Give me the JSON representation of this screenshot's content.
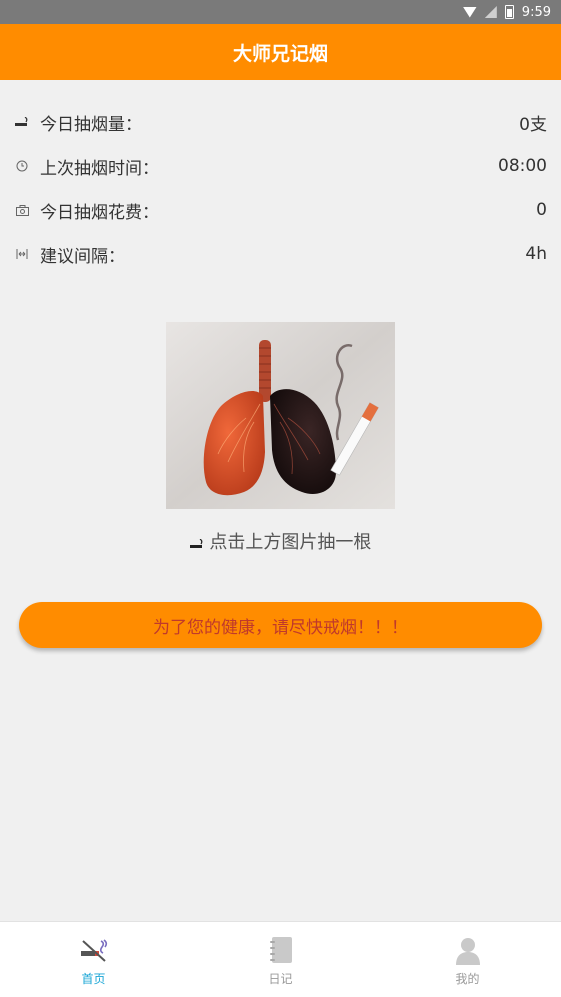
{
  "status_bar": {
    "time": "9:59"
  },
  "app_bar": {
    "title": "大师兄记烟"
  },
  "stats": [
    {
      "icon": "cigarette-icon",
      "label": "今日抽烟量：",
      "value": "0支"
    },
    {
      "icon": "clock-icon",
      "label": "上次抽烟时间：",
      "value": "08:00"
    },
    {
      "icon": "camera-icon",
      "label": "今日抽烟花费：",
      "value": "0"
    },
    {
      "icon": "interval-icon",
      "label": "建议间隔：",
      "value": "4h"
    }
  ],
  "hint": {
    "text": "点击上方图片抽一根"
  },
  "banner": {
    "text": "为了您的健康，请尽快戒烟！！！"
  },
  "nav": [
    {
      "label": "首页",
      "icon": "no-smoking-icon",
      "active": true
    },
    {
      "label": "日记",
      "icon": "notebook-icon",
      "active": false
    },
    {
      "label": "我的",
      "icon": "person-icon",
      "active": false
    }
  ],
  "colors": {
    "accent": "#ff8c00",
    "active_nav": "#1aa6d6",
    "banner_text": "#c0392b"
  }
}
